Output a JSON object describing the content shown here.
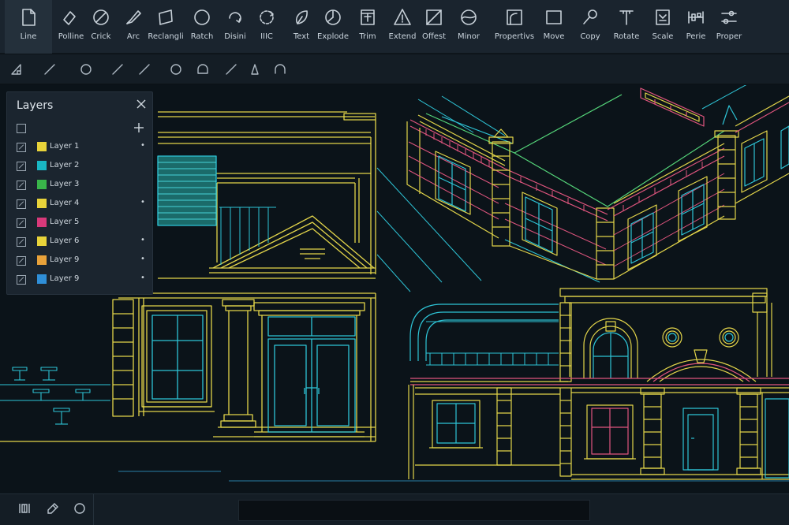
{
  "toolbar": {
    "tools": [
      {
        "label": "Line",
        "icon": "line-tool-icon",
        "active": true
      },
      {
        "label": "Polline",
        "icon": "polyline-tool-icon"
      },
      {
        "label": "Crick",
        "icon": "circle-tool-icon"
      },
      {
        "label": "Arc",
        "icon": "arc-tool-icon"
      },
      {
        "label": "Reclangli",
        "icon": "rectangle-tool-icon"
      },
      {
        "label": "Ratch",
        "icon": "hatch-tool-icon"
      },
      {
        "label": "Disini",
        "icon": "dimension-tool-icon"
      },
      {
        "label": "IIIC",
        "icon": "ellipse-tool-icon"
      },
      {
        "label": "Text",
        "icon": "text-tool-icon"
      },
      {
        "label": "Explode",
        "icon": "explode-tool-icon"
      },
      {
        "label": "Trim",
        "icon": "trim-tool-icon"
      },
      {
        "label": "Extend",
        "icon": "extend-tool-icon"
      },
      {
        "label": "Offest",
        "icon": "offset-tool-icon"
      },
      {
        "label": "Minor",
        "icon": "mirror-tool-icon"
      },
      {
        "label": "Propertivs",
        "icon": "properties-tool-icon"
      },
      {
        "label": "Move",
        "icon": "move-tool-icon"
      },
      {
        "label": "Copy",
        "icon": "copy-tool-icon"
      },
      {
        "label": "Rotate",
        "icon": "rotate-tool-icon"
      },
      {
        "label": "Scale",
        "icon": "scale-tool-icon"
      },
      {
        "label": "Perie",
        "icon": "pedit-tool-icon"
      },
      {
        "label": "Proper",
        "icon": "properties-sliders-icon"
      }
    ]
  },
  "snap_bar": {
    "icons": [
      "angle-snap-icon",
      "line-snap-icon",
      "circle-snap-icon",
      "diagonal-snap-icon",
      "perpendicular-snap-icon",
      "center-snap-icon",
      "arc-snap-icon",
      "tangent-snap-icon",
      "triangle-snap-icon",
      "dome-snap-icon"
    ]
  },
  "layers_panel": {
    "title": "Layers",
    "layers": [
      {
        "name": "Layer 1",
        "color": "#e8d33a",
        "dot": "•"
      },
      {
        "name": "Layer 2",
        "color": "#19b7c4",
        "dot": ""
      },
      {
        "name": "Layer 3",
        "color": "#39b54a",
        "dot": ""
      },
      {
        "name": "Layer 4",
        "color": "#e8d33a",
        "dot": "•"
      },
      {
        "name": "Layer 5",
        "color": "#d8397a",
        "dot": ""
      },
      {
        "name": "Layer 6",
        "color": "#e8d33a",
        "dot": "•"
      },
      {
        "name": "Layer 9",
        "color": "#e8a23a",
        "dot": "•"
      },
      {
        "name": "Layer 9",
        "color": "#2f8fd8",
        "dot": "•"
      }
    ]
  },
  "bottom_bar": {
    "icons": [
      "grid-toggle-icon",
      "snap-toggle-icon",
      "ortho-toggle-icon"
    ],
    "command_value": ""
  },
  "colors": {
    "yellow": "#e3d54a",
    "cyan": "#2ec4d6",
    "pink": "#e0557e",
    "green": "#55d67a",
    "teal_fill": "#1b6b6a"
  }
}
